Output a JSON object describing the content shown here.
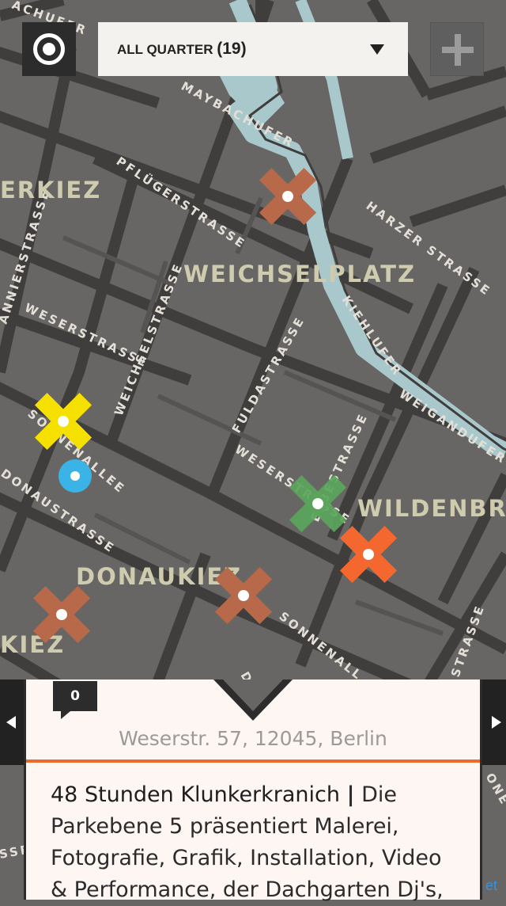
{
  "toolbar": {
    "locate_icon": "target-icon",
    "add_icon": "plus-icon",
    "filter_label": "ALL QUARTER",
    "filter_count": "(19)",
    "filter_caret_icon": "caret-down-icon"
  },
  "map": {
    "streets": {
      "maybachufer": "MAYBACHUFER",
      "pflugerstrasse": "PFLÜGERSTRASSE",
      "harzer": "HARZER STRASSE",
      "weserstrasse": "WESERSTRASSE",
      "weichselstrasse": "WEICHSELSTRASSE",
      "fuldastrasse": "FULDASTRASSE",
      "kiehlufer": "KIEHLUFER",
      "weigandufer": "WEIGANDUFER",
      "elbestrasse": "ELBESTRASSE",
      "weserstrasse_lower": "WESERSTRASSE",
      "sonnenallee": "SONNENALLEE",
      "sonnenallee_lower": "SONNENALL",
      "donaustrasse": "DONAUSTRASSE",
      "annierstrasse": "ANNIERSTRASSE",
      "top_corner": "ACHUFER",
      "don": "DON",
      "strasse_right": "STRASSE",
      "sse_left": "SSE",
      "one_right": "ONE"
    },
    "neighborhoods": {
      "erkiez": "ERKIEZ",
      "weichselplatz": "WEICHSELPLATZ",
      "wildenbruch": "WILDENBRU",
      "donaukiez": "DONAUKIEZ",
      "kiez": "KIEZ"
    },
    "colors": {
      "water": "#a9c8cc",
      "marker_brown": "#b8694a",
      "marker_yellow": "#f5e000",
      "marker_green": "#5aa55b",
      "marker_orange": "#f4682f",
      "user_location": "#3ab4e6"
    }
  },
  "card": {
    "comment_count": "0",
    "address": "Weserstr. 57, 12045, Berlin",
    "title": "48 Stunden Klunkerkranich",
    "separator": "|",
    "description": "Die Parkebene 5 präsentiert Malerei, Fotografie, Grafik, Installation, Video & Performance, der Dachgarten Dj's,",
    "accent_color": "#ec6a2b"
  },
  "nav": {
    "prev_icon": "arrow-left-icon",
    "next_icon": "arrow-right-icon"
  },
  "attribution": "et"
}
